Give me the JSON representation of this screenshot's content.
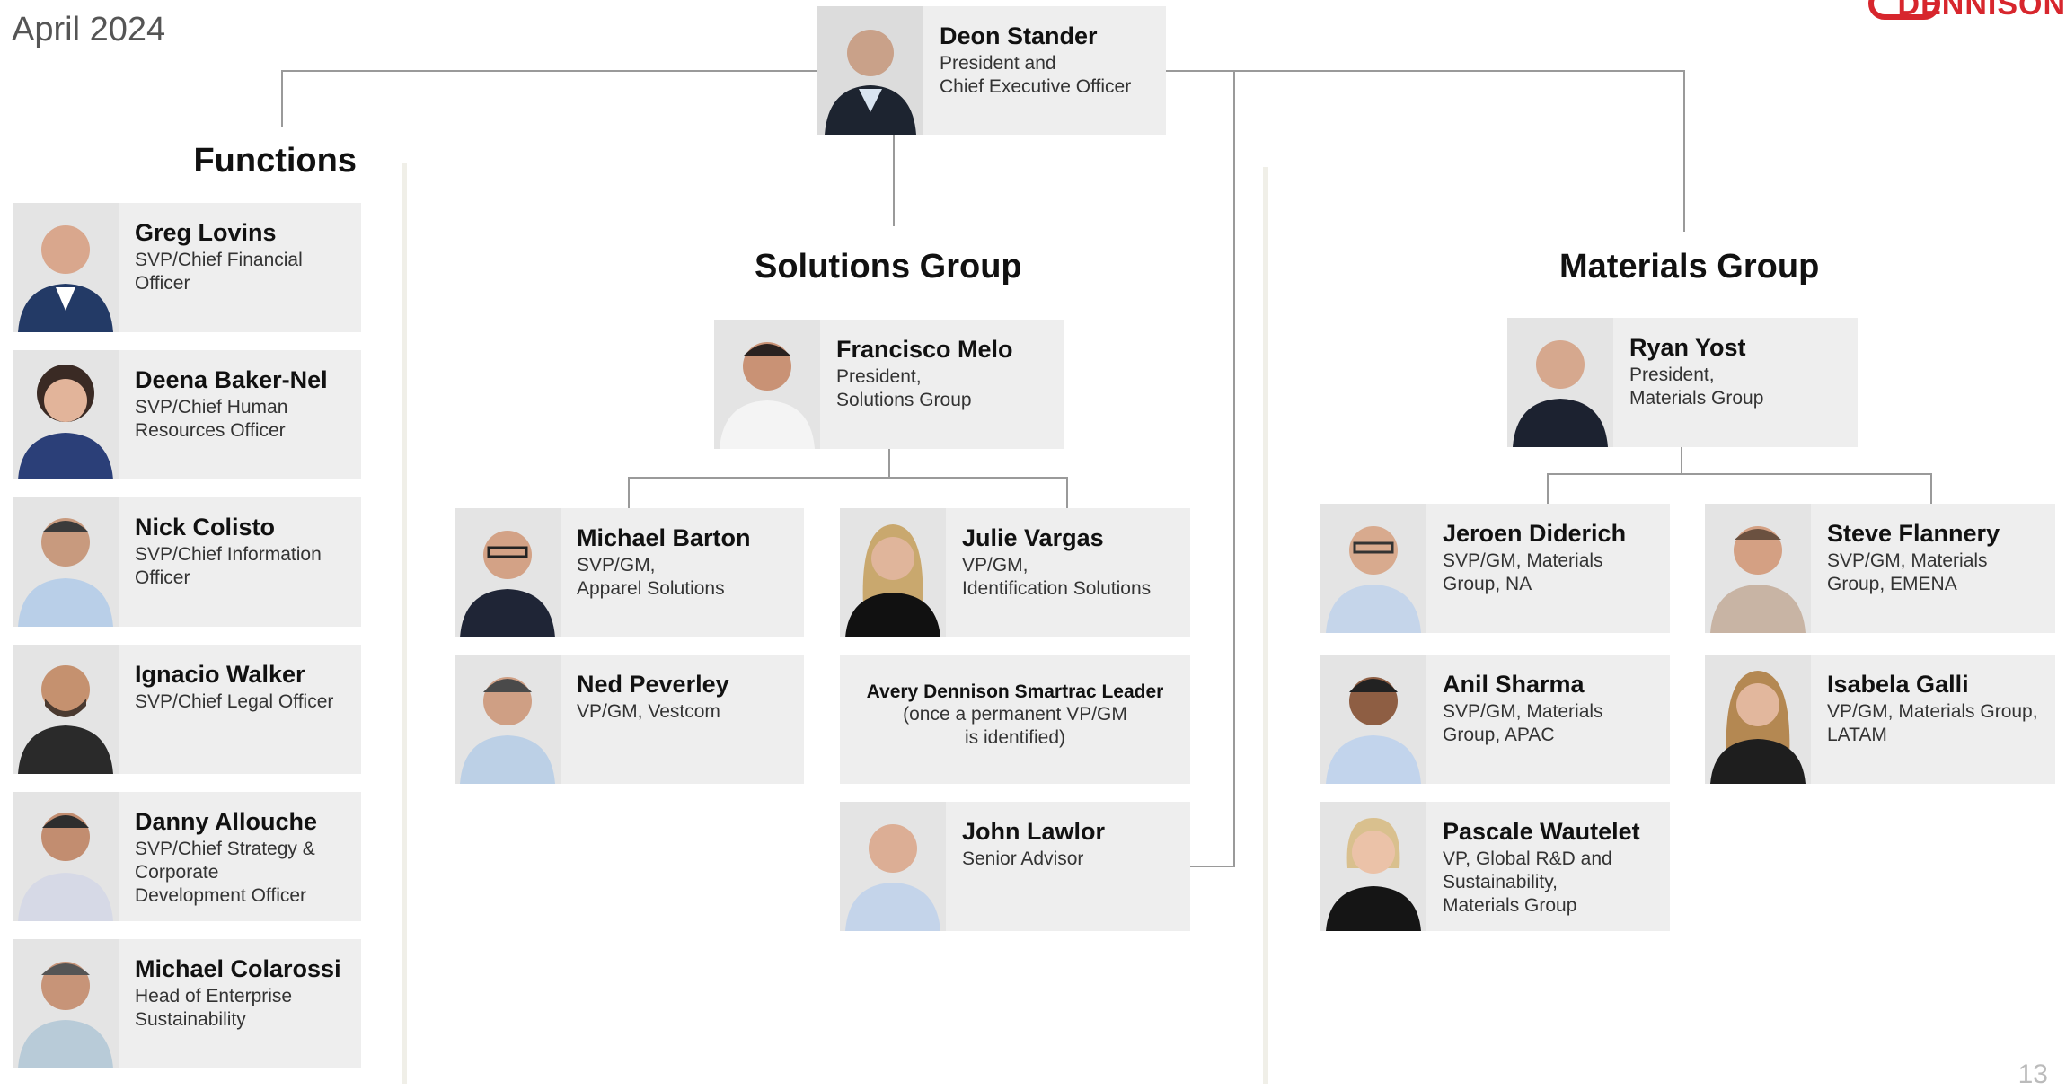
{
  "header": {
    "date": "April 2024",
    "page_number": "13",
    "logo_text": "DENNISON"
  },
  "ceo": {
    "name": "Deon Stander",
    "title": "President and\nChief Executive Officer"
  },
  "functions": {
    "heading": "Functions",
    "people": [
      {
        "name": "Greg Lovins",
        "title": "SVP/Chief Financial\nOfficer"
      },
      {
        "name": "Deena Baker-Nel",
        "title": "SVP/Chief Human\nResources Officer"
      },
      {
        "name": "Nick Colisto",
        "title": "SVP/Chief Information\nOfficer"
      },
      {
        "name": "Ignacio Walker",
        "title": "SVP/Chief Legal Officer"
      },
      {
        "name": "Danny Allouche",
        "title": "SVP/Chief Strategy &\nCorporate\nDevelopment Officer"
      },
      {
        "name": "Michael Colarossi",
        "title": "Head of Enterprise\nSustainability"
      }
    ]
  },
  "solutions": {
    "heading": "Solutions Group",
    "leader": {
      "name": "Francisco Melo",
      "title": "President,\nSolutions Group"
    },
    "people": [
      {
        "name": "Michael Barton",
        "title": "SVP/GM,\nApparel Solutions"
      },
      {
        "name": "Julie Vargas",
        "title": "VP/GM,\nIdentification Solutions"
      },
      {
        "name": "Ned Peverley",
        "title": "VP/GM, Vestcom"
      },
      {
        "name": "Avery Dennison Smartrac Leader",
        "title": "(once a permanent VP/GM\nis identified)"
      },
      {
        "name": "John Lawlor",
        "title": "Senior Advisor"
      }
    ]
  },
  "materials": {
    "heading": "Materials Group",
    "leader": {
      "name": "Ryan Yost",
      "title": "President,\nMaterials Group"
    },
    "people": [
      {
        "name": "Jeroen Diderich",
        "title": "SVP/GM, Materials\nGroup, NA"
      },
      {
        "name": "Steve Flannery",
        "title": "SVP/GM, Materials\nGroup, EMENA"
      },
      {
        "name": "Anil Sharma",
        "title": "SVP/GM, Materials\nGroup, APAC"
      },
      {
        "name": "Isabela Galli",
        "title": "VP/GM, Materials Group,\nLATAM"
      },
      {
        "name": "Pascale Wautelet",
        "title": "VP, Global R&D and\nSustainability,\nMaterials Group"
      }
    ]
  },
  "colors": {
    "card_bg": "#eeeeee",
    "connector": "#999999",
    "brand_red": "#d7262d"
  }
}
